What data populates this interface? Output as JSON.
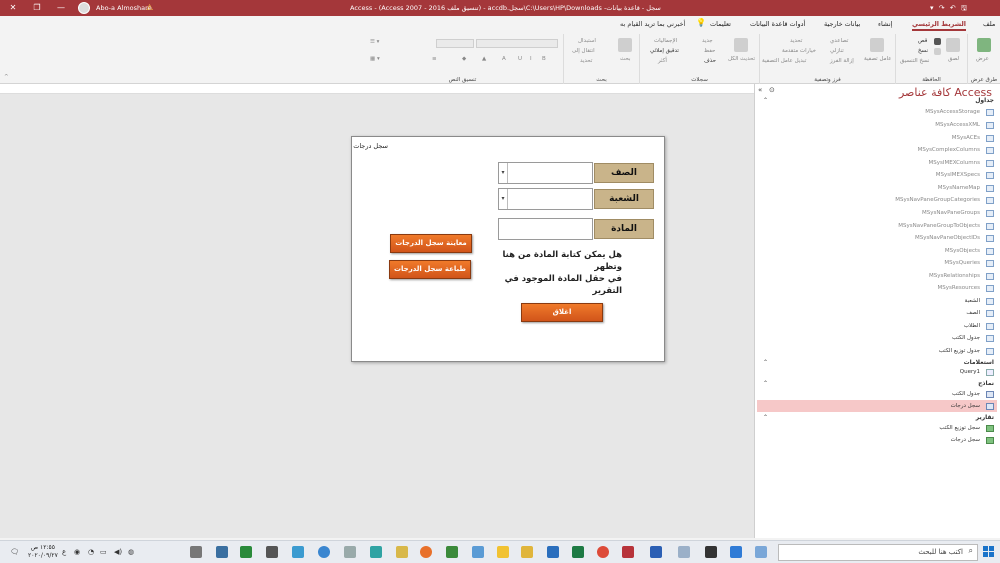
{
  "titlebar": {
    "title": "سجل  -  قاعدة بيانات- C:\\Users\\HP\\Downloads\\سجل.accdb  -  (تنسيق ملف Access 2007 - 2016)  -  Access",
    "user_name": "Abo-a Almoshare",
    "min": "—",
    "restore": "❐",
    "close": "✕"
  },
  "tabs": [
    {
      "label": "ملف"
    },
    {
      "label": "الشريط الرئيسي"
    },
    {
      "label": "إنشاء"
    },
    {
      "label": "بيانات خارجية"
    },
    {
      "label": "أدوات قاعدة البيانات"
    },
    {
      "label": "تعليمات"
    }
  ],
  "tell_me": "أخبرني بما تريد القيام به",
  "ribbon": {
    "groups": {
      "views": "طرق عرض",
      "clipboard": "الحافظة",
      "sort_filter": "فرز وتصفية",
      "records": "سجلات",
      "find": "بحث",
      "text_format": "تنسيق النص"
    },
    "buttons": {
      "view": "عرض",
      "paste": "لصق",
      "cut": "قص",
      "copy": "نسخ",
      "format_painter": "نسخ التنسيق",
      "filter": "عامل تصفية",
      "ascending": "تصاعدي",
      "descending": "تنازلي",
      "remove_sort": "إزالة الفرز",
      "selection": "تحديد",
      "advanced": "خيارات متقدمة",
      "toggle_filter": "تبديل عامل التصفية",
      "refresh_all": "تحديث الكل",
      "new": "جديد",
      "save": "حفظ",
      "delete": "حذف",
      "totals": "الإجماليات",
      "spelling": "تدقيق إملائي",
      "more": "أكثر",
      "find": "بحث",
      "replace": "استبدال",
      "goto": "انتقال إلى",
      "select": "تحديد"
    }
  },
  "form": {
    "title": "سجل درجات",
    "label_class": "الصف",
    "label_section": "الشعبة",
    "label_subject": "المادة",
    "note_line1": "هل يمكن كتابة المادة  من هنا وتظهر",
    "note_line2": "في حقل المادة الموجود في التقرير",
    "btn_preview": "معاينة سجل الدرجات",
    "btn_print": "طباعة سجل الدرجات",
    "btn_close": "اغلاق"
  },
  "nav": {
    "header": "كافة عناصر Access",
    "sections": {
      "tables": "جداول",
      "queries": "استعلامات",
      "forms": "نماذج",
      "reports": "تقارير"
    },
    "tables": [
      "MSysAccessStorage",
      "MSysAccessXML",
      "MSysACEs",
      "MSysComplexColumns",
      "MSysIMEXColumns",
      "MSysIMEXSpecs",
      "MSysNameMap",
      "MSysNavPaneGroupCategories",
      "MSysNavPaneGroups",
      "MSysNavPaneGroupToObjects",
      "MSysNavPaneObjectIDs",
      "MSysObjects",
      "MSysQueries",
      "MSysRelationships",
      "MSysResources"
    ],
    "user_tables": [
      "الشعبة",
      "الصف",
      "الطلاب",
      "جدول الكتب",
      "جدول توزيع الكتب"
    ],
    "queries": [
      "Query1"
    ],
    "forms": [
      "جدول الكتب",
      "سجل درجات"
    ],
    "reports": [
      "سجل توزيع الكتب",
      "سجل درجات"
    ]
  },
  "taskbar": {
    "search_placeholder": "اكتب هنا للبحث",
    "time": "١٢:٥٥ ص",
    "date": "٢٠٢٠/٠٩/٢٧",
    "lang": "ع"
  },
  "colors": {
    "accent": "#a4373a",
    "label_bg": "#c9b48a",
    "button_orange": "#e8691f",
    "selected": "#f6c8c8"
  }
}
